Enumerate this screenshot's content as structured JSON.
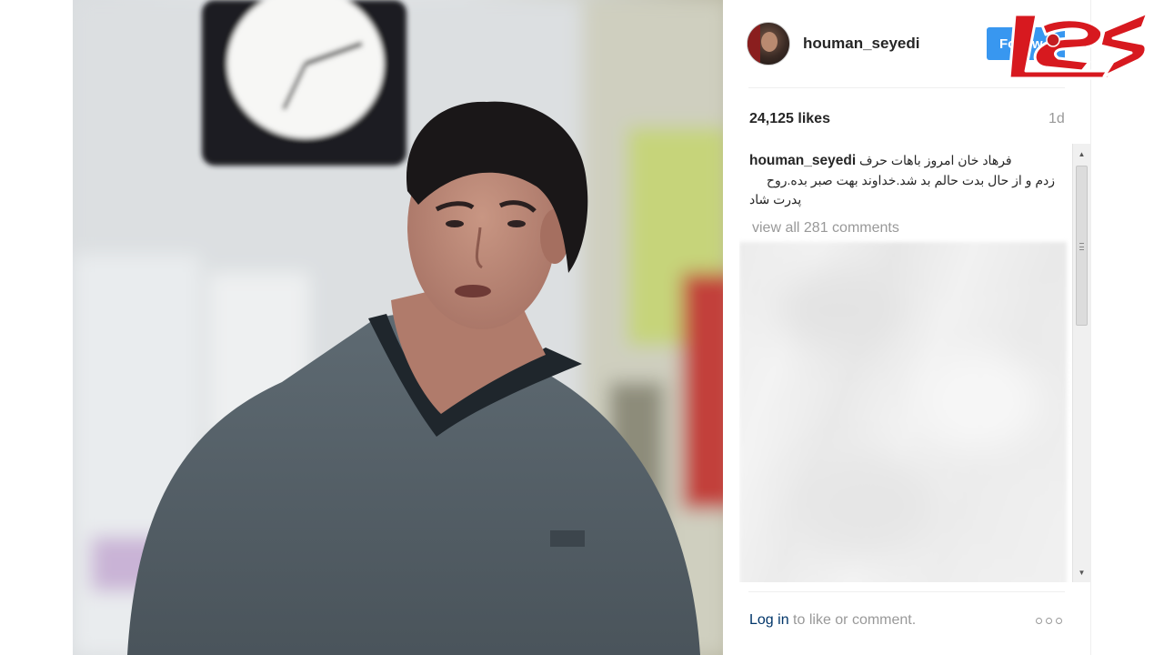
{
  "post": {
    "username": "houman_seyedi",
    "follow_label": "Follow",
    "likes": "24,125 likes",
    "time": "1d",
    "caption_user": "houman_seyedi",
    "caption_lines": [
      "فرهاد خان امروز باهات حرف",
      "زدم و از حال بدت حالم بد شد.خداوند بهت صبر بده.روح",
      "پدرت شاد"
    ],
    "view_all": "view all 281 comments",
    "footer_login": "Log in",
    "footer_rest": " to like or comment."
  },
  "icons": {
    "more": "more-options-icon",
    "scroll_up": "scroll-up-arrow-icon",
    "scroll_down": "scroll-down-arrow-icon"
  },
  "colors": {
    "follow": "#3897f0",
    "username": "#262626",
    "muted": "#999999",
    "link": "#003569",
    "logo_red": "#d7191f"
  }
}
